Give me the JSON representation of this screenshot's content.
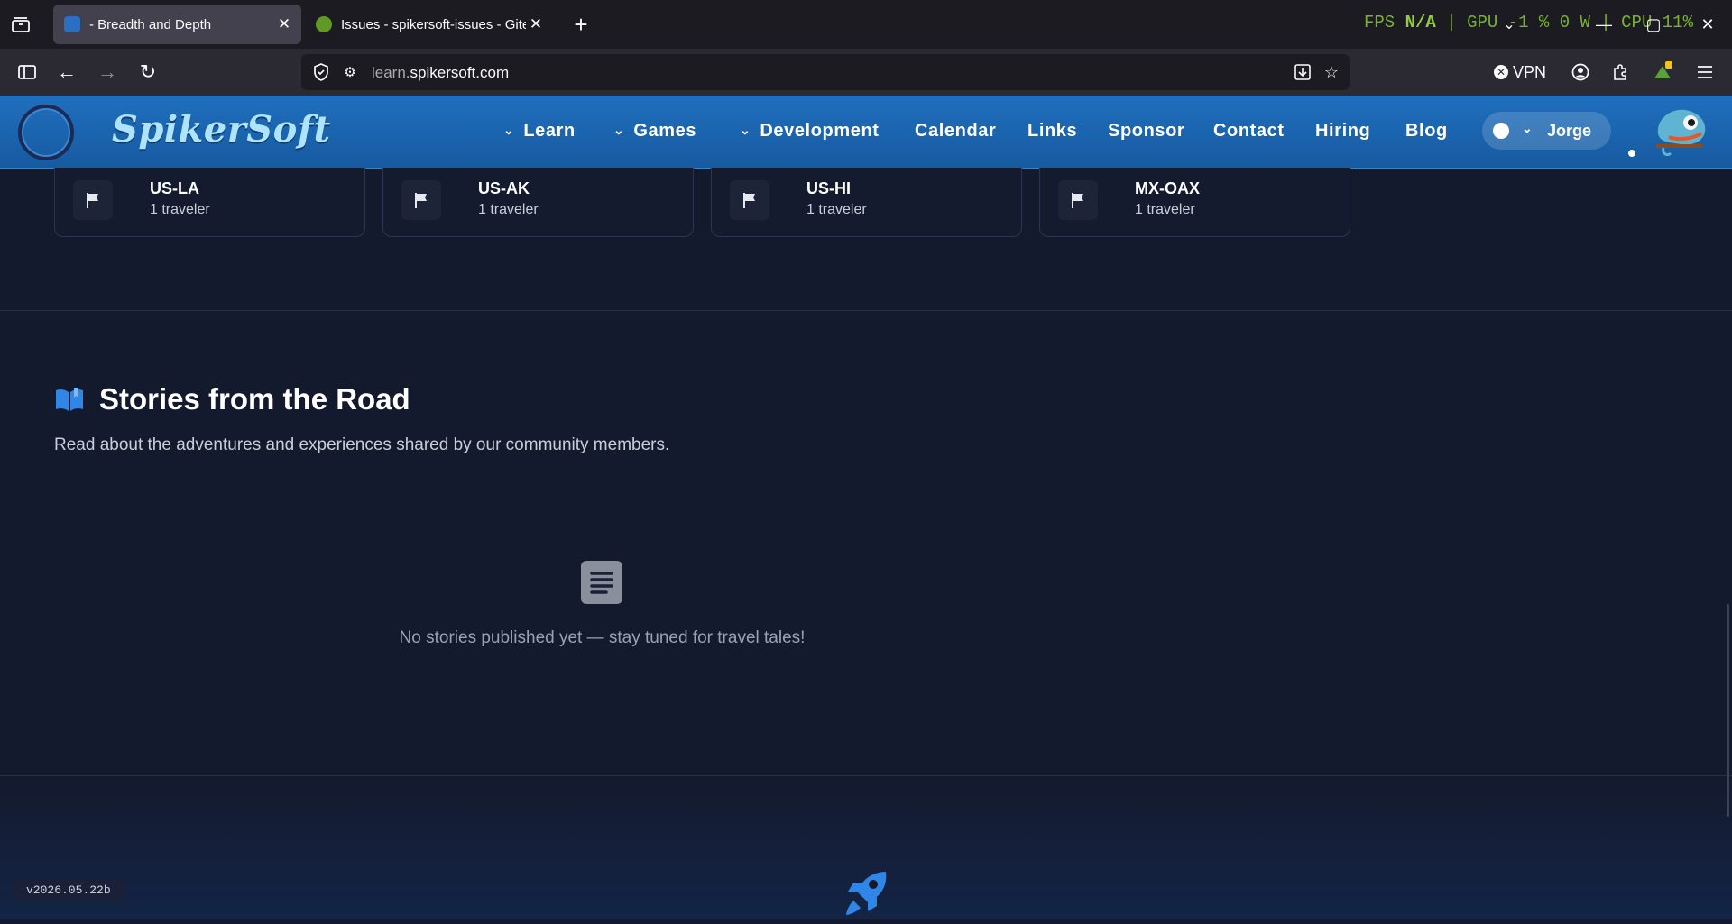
{
  "browser": {
    "tabs": [
      {
        "title": "- Breadth and Depth",
        "active": true
      },
      {
        "title": "Issues - spikersoft-issues - Gitea",
        "active": false
      }
    ],
    "url_host_dim": "learn.",
    "url_host": "spikersoft.com",
    "vpn_label": "VPN",
    "hud": {
      "fps_label": "FPS",
      "fps_value": "N/A",
      "gpu_label": "GPU",
      "gpu_value": "-1 %",
      "gpu_power": "0 W",
      "cpu_label": "CPU",
      "cpu_value": "11%"
    }
  },
  "site": {
    "logo": "SpikerSoft",
    "nav": {
      "learn": "Learn",
      "games": "Games",
      "development": "Development",
      "calendar": "Calendar",
      "links": "Links",
      "sponsor": "Sponsor",
      "contact": "Contact",
      "hiring": "Hiring",
      "blog": "Blog"
    },
    "user": "Jorge"
  },
  "locations": [
    {
      "code": "US-LA",
      "count": "1 traveler"
    },
    {
      "code": "US-AK",
      "count": "1 traveler"
    },
    {
      "code": "US-HI",
      "count": "1 traveler"
    },
    {
      "code": "MX-OAX",
      "count": "1 traveler"
    }
  ],
  "stories": {
    "title": "Stories from the Road",
    "subtitle": "Read about the adventures and experiences shared by our community members.",
    "empty": "No stories published yet — stay tuned for travel tales!"
  },
  "version": "v2026.05.22b",
  "colors": {
    "accent": "#1f6fbe",
    "page_bg": "#141a2e",
    "rocket": "#2f86e6"
  }
}
